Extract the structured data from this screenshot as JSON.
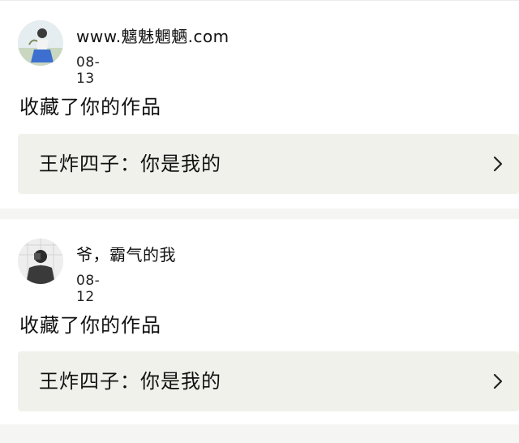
{
  "feed": {
    "items": [
      {
        "avatar_icon": "user-avatar-icon",
        "user_name": "www.魑魅魍魉.com",
        "date": "08-13",
        "action": "收藏了你的作品",
        "work_title": "王炸四子：你是我的",
        "chevron_icon": "chevron-right-icon"
      },
      {
        "avatar_icon": "user-avatar-icon",
        "user_name": "爷，霸气的我",
        "date": "08-12",
        "action": "收藏了你的作品",
        "work_title": "王炸四子：你是我的",
        "chevron_icon": "chevron-right-icon"
      }
    ]
  },
  "colors": {
    "background": "#f5f5f4",
    "card": "#ffffff",
    "work_box": "#f1f1ec",
    "text": "#111111"
  }
}
